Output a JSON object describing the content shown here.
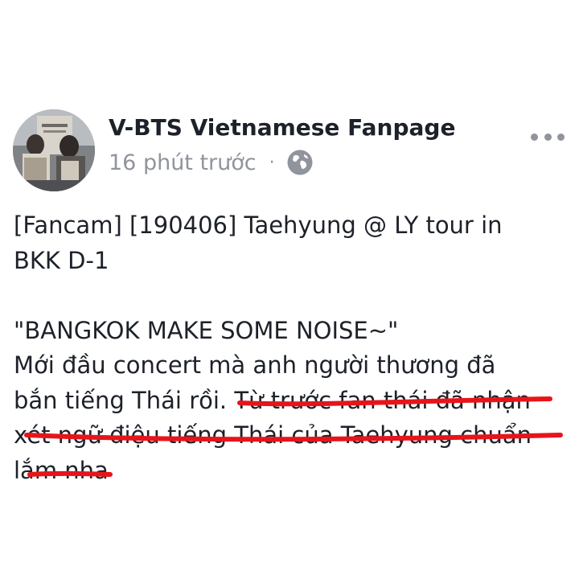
{
  "post": {
    "page_name": "V-BTS Vietnamese Fanpage",
    "timestamp": "16 phút trước",
    "separator": "·",
    "privacy_icon": "globe-icon",
    "more_icon": "more-dots-icon",
    "avatar_icon": "page-avatar",
    "text_lines": [
      "[Fancam] [190406] Taehyung @ LY tour in",
      "BKK D-1",
      "",
      "\"BANGKOK MAKE SOME NOISE~\"",
      "Mới đầu concert mà anh người thương đã",
      "bắn tiếng Thái rồi. Từ trước fan thái đã nhận",
      "xét ngữ điệu tiếng Thái của Taehyung chuẩn",
      "lắm nha"
    ]
  },
  "colors": {
    "text": "#1d2129",
    "secondary": "#90949c",
    "annotation_red": "#e8141b",
    "background": "#ffffff"
  }
}
